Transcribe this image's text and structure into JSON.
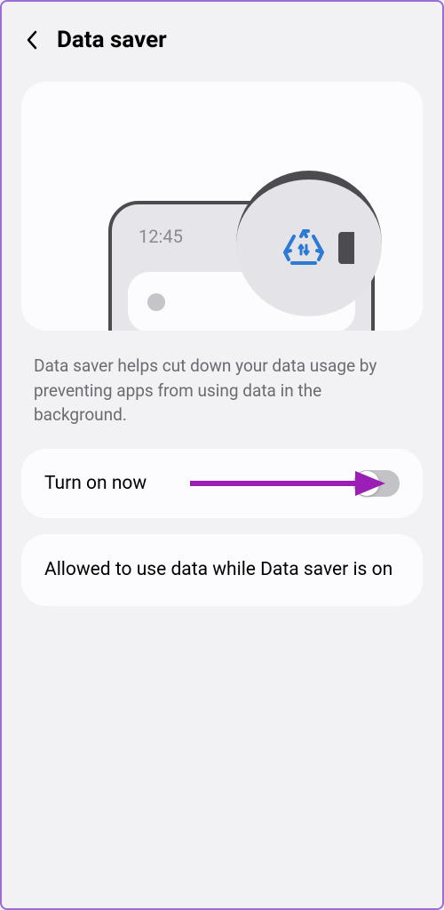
{
  "header": {
    "title": "Data saver"
  },
  "illustration": {
    "phone_time": "12:45"
  },
  "description": "Data saver helps cut down your data usage by preventing apps from using data in the background.",
  "option_toggle": {
    "label": "Turn on now",
    "state": "off"
  },
  "option_link": {
    "label": "Allowed to use data while Data saver is on"
  },
  "colors": {
    "accent_icon": "#2d7ad6",
    "annotation_arrow": "#9c1fb5"
  }
}
